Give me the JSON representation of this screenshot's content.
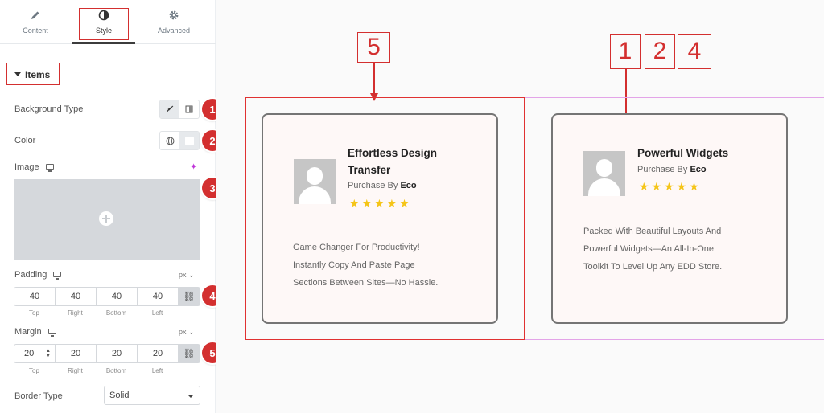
{
  "tabs": [
    {
      "label": "Content",
      "icon": "pencil-icon"
    },
    {
      "label": "Style",
      "icon": "contrast-icon"
    },
    {
      "label": "Advanced",
      "icon": "gear-icon"
    }
  ],
  "section": {
    "title": "Items"
  },
  "controls": {
    "background_type": "Background Type",
    "color": "Color",
    "image": "Image",
    "padding": "Padding",
    "margin": "Margin",
    "border_type": "Border Type",
    "border_type_value": "Solid",
    "unit": "px"
  },
  "padding": {
    "top": "40",
    "right": "40",
    "bottom": "40",
    "left": "40"
  },
  "margin": {
    "top": "20",
    "right": "20",
    "bottom": "20",
    "left": "20"
  },
  "dim_labels": {
    "top": "Top",
    "right": "Right",
    "bottom": "Bottom",
    "left": "Left"
  },
  "badges": [
    "1",
    "2",
    "3",
    "4",
    "5"
  ],
  "callouts": {
    "left": "5",
    "right": [
      "1",
      "2",
      "4"
    ]
  },
  "cards": [
    {
      "title_line1": "Effortless Design",
      "title_line2": "Transfer",
      "purchase": "Purchase By",
      "author": "Eco",
      "stars": "★★★★★",
      "text": [
        "Game Changer For Productivity!",
        "Instantly Copy And Paste Page",
        "Sections Between Sites—No Hassle."
      ]
    },
    {
      "title_line1": "Powerful Widgets",
      "purchase": "Purchase By",
      "author": "Eco",
      "stars": "★★★★★",
      "text": [
        "Packed With Beautiful Layouts And",
        "Powerful Widgets—An All-In-One",
        "Toolkit To Level Up Any EDD Store."
      ]
    }
  ],
  "colors": {
    "accent_red": "#d32f2f",
    "guide_pink": "#e3a4e8",
    "star": "#f5c518",
    "card_bg": "#fef8f7"
  }
}
